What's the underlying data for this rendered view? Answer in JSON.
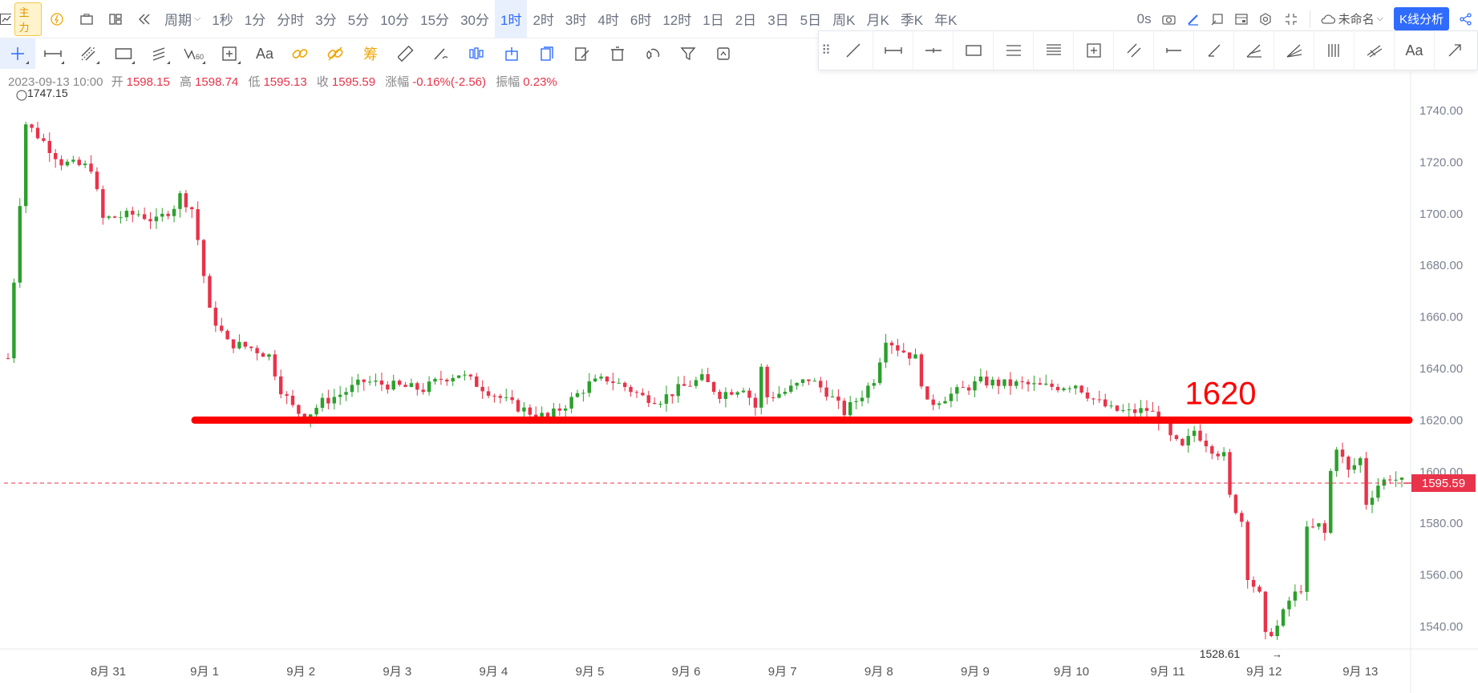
{
  "topbar": {
    "main_badge": "主力",
    "period_label": "周期",
    "intervals": [
      "1秒",
      "1分",
      "分时",
      "3分",
      "5分",
      "10分",
      "15分",
      "30分",
      "1时",
      "2时",
      "3时",
      "4时",
      "6时",
      "12时",
      "1日",
      "2日",
      "3日",
      "5日",
      "周K",
      "月K",
      "季K",
      "年K"
    ],
    "active_interval": "1时",
    "countdown": "0s",
    "layout_name": "未命名",
    "analysis_button": "K线分析",
    "colors": {
      "active_bg": "#e8f0fe",
      "accent": "#2f6bff"
    }
  },
  "toolbar2": {
    "text_tool": "Aa",
    "chip_tool": "筹",
    "icons": [
      "crosshair-icon",
      "horizontal-measure-icon",
      "parallel-lines-icon",
      "rectangle-icon",
      "fib-icon",
      "wave-icon",
      "zoom-box-icon",
      "text-icon",
      "link-icon",
      "unlink-icon",
      "chips-icon",
      "ruler-icon",
      "pen-icon",
      "candles-icon",
      "lock-icon",
      "bookmark-icon",
      "edit-icon",
      "trash-icon",
      "magnet-icon",
      "filter-icon",
      "sync-icon"
    ]
  },
  "draw_panel": {
    "text_tool": "Aa",
    "tools": [
      "trend-line-icon",
      "range-line-icon",
      "horizontal-ray-icon",
      "rectangle-icon",
      "parallel-channel-icon",
      "fib-retracement-icon",
      "zoom-box-icon",
      "parallel-lines-icon",
      "horizontal-segment-icon",
      "ray-icon",
      "angle-icon",
      "fan-icon",
      "vertical-lines-icon",
      "pitchfork-icon",
      "text-icon",
      "arrow-icon"
    ]
  },
  "info": {
    "datetime": "2023-09-13 10:00",
    "open_label": "开",
    "open": "1598.15",
    "high_label": "高",
    "high": "1598.74",
    "low_label": "低",
    "low": "1595.13",
    "close_label": "收",
    "close": "1595.59",
    "change_label": "涨幅",
    "change": "-0.16%(-2.56)",
    "amplitude_label": "振幅",
    "amplitude": "0.23%"
  },
  "chart_data": {
    "type": "candlestick",
    "ylim": [
      1526,
      1752
    ],
    "y_ticks": [
      1540,
      1560,
      1580,
      1600,
      1620,
      1640,
      1660,
      1680,
      1700,
      1720,
      1740
    ],
    "y_tick_labels": [
      "1540.00",
      "1560.00",
      "1580.00",
      "1600.00",
      "1620.00",
      "1640.00",
      "1660.00",
      "1680.00",
      "1700.00",
      "1720.00",
      "1740.00"
    ],
    "x_labels": [
      "8月 31",
      "9月 1",
      "9月 2",
      "9月 3",
      "9月 4",
      "9月 5",
      "9月 6",
      "9月 7",
      "9月 8",
      "9月 9",
      "9月 10",
      "9月 11",
      "9月 12",
      "9月 13"
    ],
    "current_price": "1595.59",
    "current_price_value": 1595.59,
    "high_marker": "1747.15",
    "high_value": 1747.15,
    "low_marker": "1528.61",
    "low_value": 1528.61,
    "annotation_line_value": 1620,
    "annotation_text": "1620",
    "up_color": "#2ca02c",
    "down_color": "#e8334a",
    "annotation_color": "#ff0000",
    "path_points": [
      [
        0,
        1644
      ],
      [
        3,
        1735
      ],
      [
        6,
        1728
      ],
      [
        9,
        1720
      ],
      [
        11,
        1719
      ],
      [
        14,
        1718
      ],
      [
        16,
        1698
      ],
      [
        19,
        1699
      ],
      [
        22,
        1700
      ],
      [
        25,
        1697
      ],
      [
        28,
        1703
      ],
      [
        29,
        1707
      ],
      [
        31,
        1702
      ],
      [
        32,
        1690
      ],
      [
        34,
        1662
      ],
      [
        37,
        1650
      ],
      [
        41,
        1648
      ],
      [
        44,
        1645
      ],
      [
        46,
        1632
      ],
      [
        48,
        1625
      ],
      [
        50,
        1621
      ],
      [
        53,
        1627
      ],
      [
        56,
        1630
      ],
      [
        60,
        1635
      ],
      [
        63,
        1634
      ],
      [
        66,
        1633
      ],
      [
        70,
        1632
      ],
      [
        73,
        1636
      ],
      [
        76,
        1638
      ],
      [
        79,
        1634
      ],
      [
        82,
        1630
      ],
      [
        85,
        1626
      ],
      [
        88,
        1623
      ],
      [
        91,
        1621
      ],
      [
        94,
        1626
      ],
      [
        98,
        1634
      ],
      [
        101,
        1636
      ],
      [
        104,
        1633
      ],
      [
        107,
        1629
      ],
      [
        110,
        1628
      ],
      [
        113,
        1632
      ],
      [
        117,
        1636
      ],
      [
        120,
        1630
      ],
      [
        124,
        1633
      ],
      [
        126,
        1625
      ],
      [
        127,
        1640
      ],
      [
        128,
        1629
      ],
      [
        131,
        1631
      ],
      [
        135,
        1636
      ],
      [
        138,
        1631
      ],
      [
        141,
        1623
      ],
      [
        144,
        1630
      ],
      [
        146,
        1636
      ],
      [
        148,
        1652
      ],
      [
        150,
        1648
      ],
      [
        153,
        1644
      ],
      [
        155,
        1626
      ],
      [
        158,
        1629
      ],
      [
        161,
        1632
      ],
      [
        164,
        1635
      ],
      [
        168,
        1634
      ],
      [
        171,
        1634
      ],
      [
        174,
        1633
      ],
      [
        177,
        1633
      ],
      [
        180,
        1634
      ],
      [
        183,
        1628
      ],
      [
        186,
        1624
      ],
      [
        189,
        1623
      ],
      [
        192,
        1624
      ],
      [
        194,
        1621
      ],
      [
        196,
        1613
      ],
      [
        198,
        1609
      ],
      [
        200,
        1616
      ],
      [
        203,
        1609
      ],
      [
        205,
        1606
      ],
      [
        206,
        1590
      ],
      [
        208,
        1581
      ],
      [
        209,
        1560
      ],
      [
        211,
        1552
      ],
      [
        212,
        1536
      ],
      [
        214,
        1540
      ],
      [
        216,
        1550
      ],
      [
        218,
        1555
      ],
      [
        219,
        1577
      ],
      [
        221,
        1579
      ],
      [
        222,
        1576
      ],
      [
        223,
        1600
      ],
      [
        224,
        1610
      ],
      [
        226,
        1600
      ],
      [
        228,
        1605
      ],
      [
        229,
        1588
      ],
      [
        231,
        1595
      ],
      [
        233,
        1598
      ],
      [
        235,
        1596
      ]
    ],
    "n_candles": 236
  }
}
